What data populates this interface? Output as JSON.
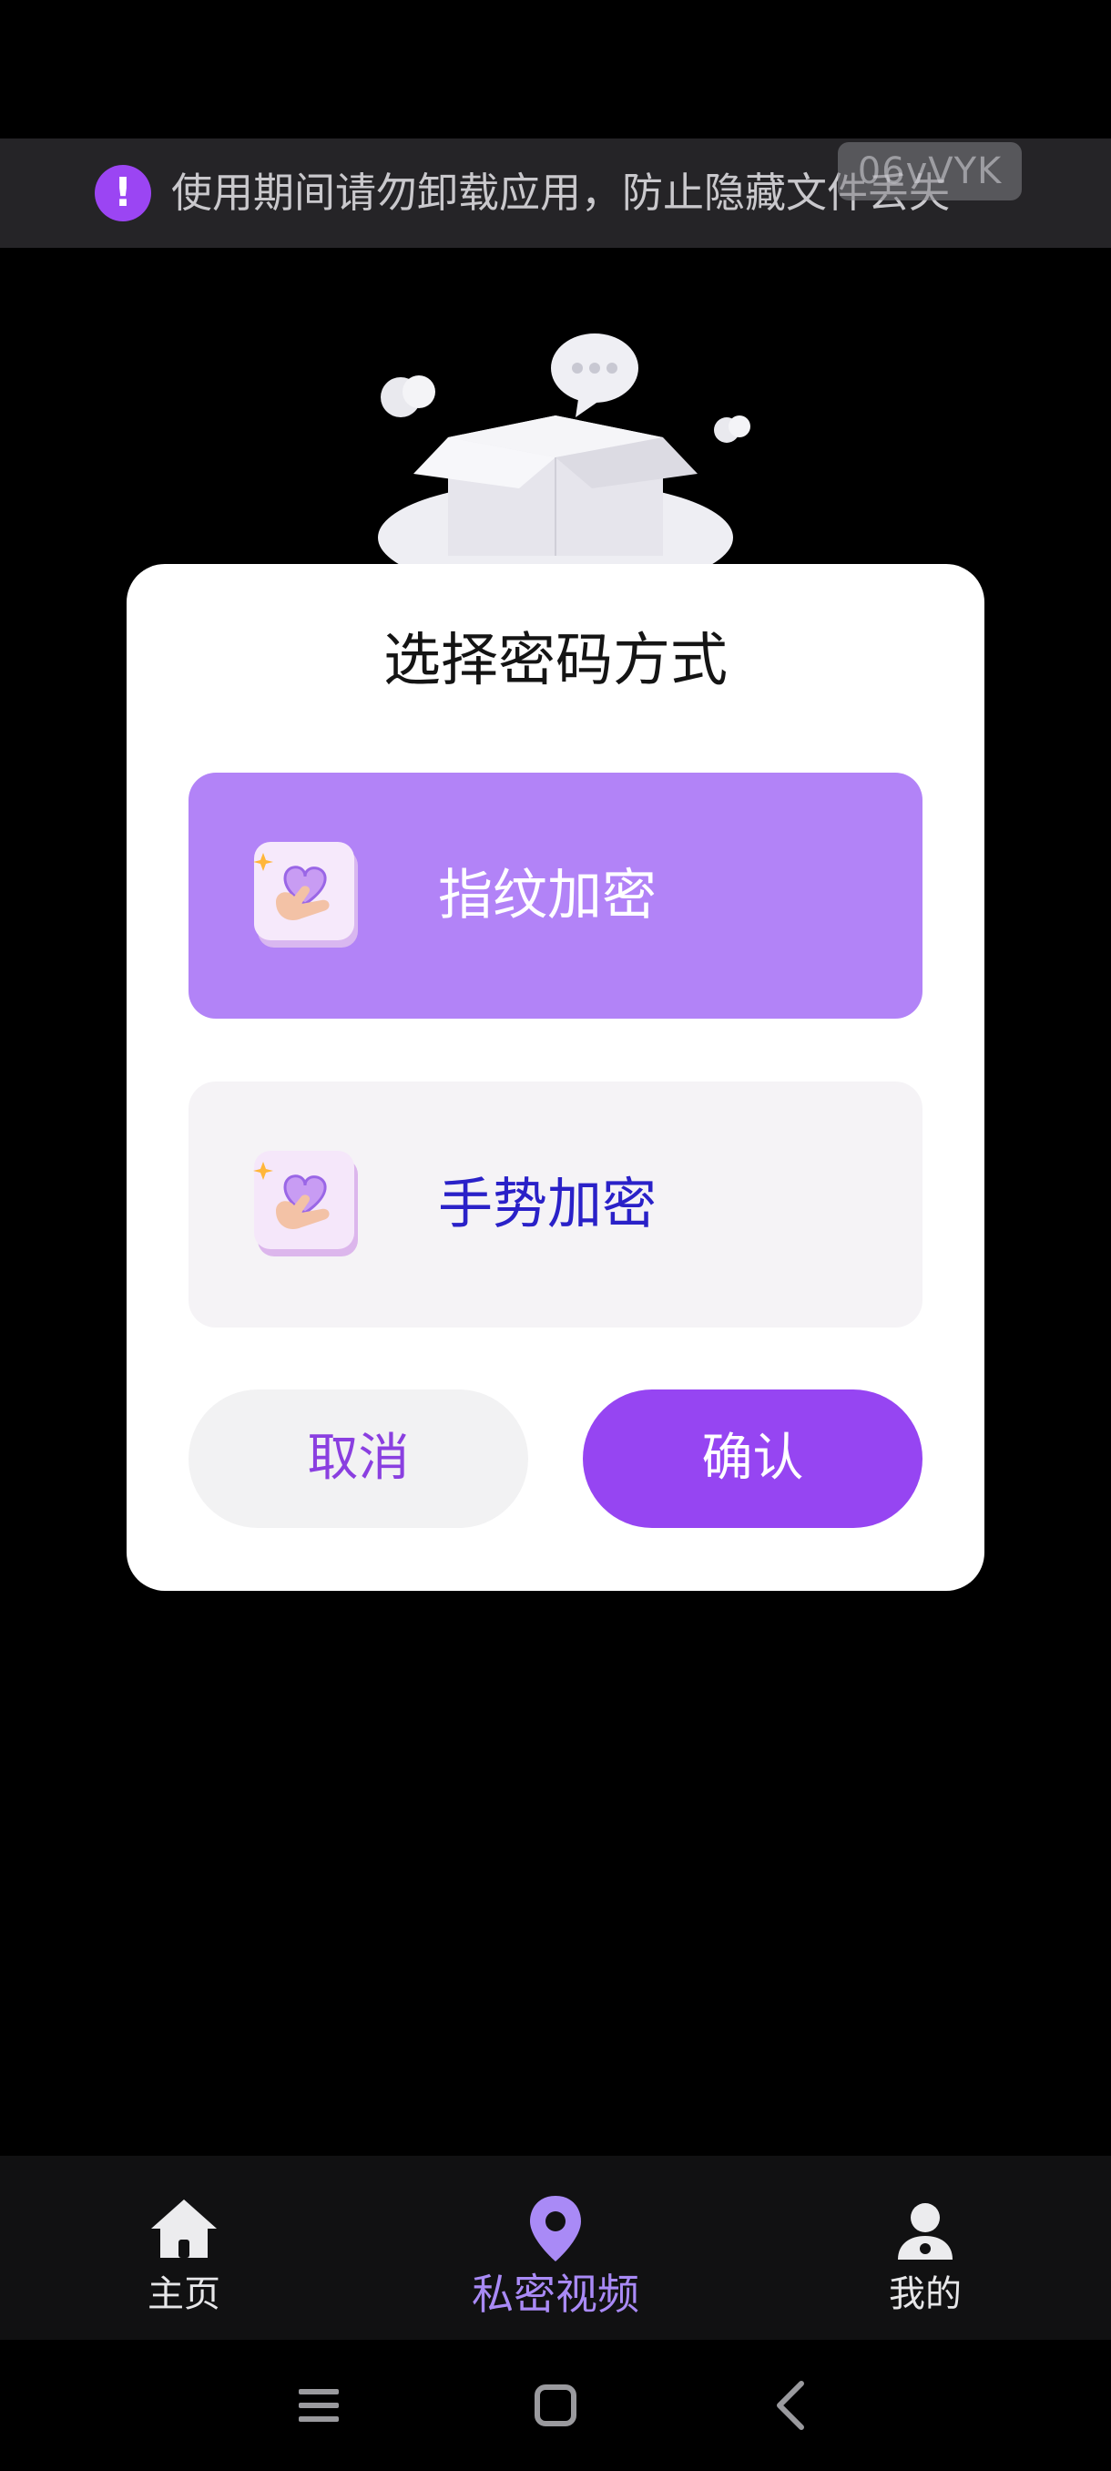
{
  "notice": {
    "icon": "exclamation-icon",
    "text": "使用期间请勿卸载应用，防止隐藏文件丢失",
    "watermark": "06vVYK"
  },
  "dialog": {
    "title": "选择密码方式",
    "options": [
      {
        "label": "指纹加密",
        "icon": "fingerprint-hand-icon",
        "selected": true
      },
      {
        "label": "手势加密",
        "icon": "gesture-hand-icon",
        "selected": false
      }
    ],
    "cancel_label": "取消",
    "confirm_label": "确认"
  },
  "tabbar": {
    "items": [
      {
        "label": "主页",
        "icon": "home-icon",
        "active": false
      },
      {
        "label": "私密视频",
        "icon": "location-pin-icon",
        "active": true
      },
      {
        "label": "我的",
        "icon": "user-icon",
        "active": false
      }
    ]
  },
  "system_nav": [
    "menu-icon",
    "home-square-icon",
    "back-icon"
  ],
  "colors": {
    "accent": "#9645f2",
    "selected_option": "#b283f7",
    "active_tab": "#a98af6"
  }
}
